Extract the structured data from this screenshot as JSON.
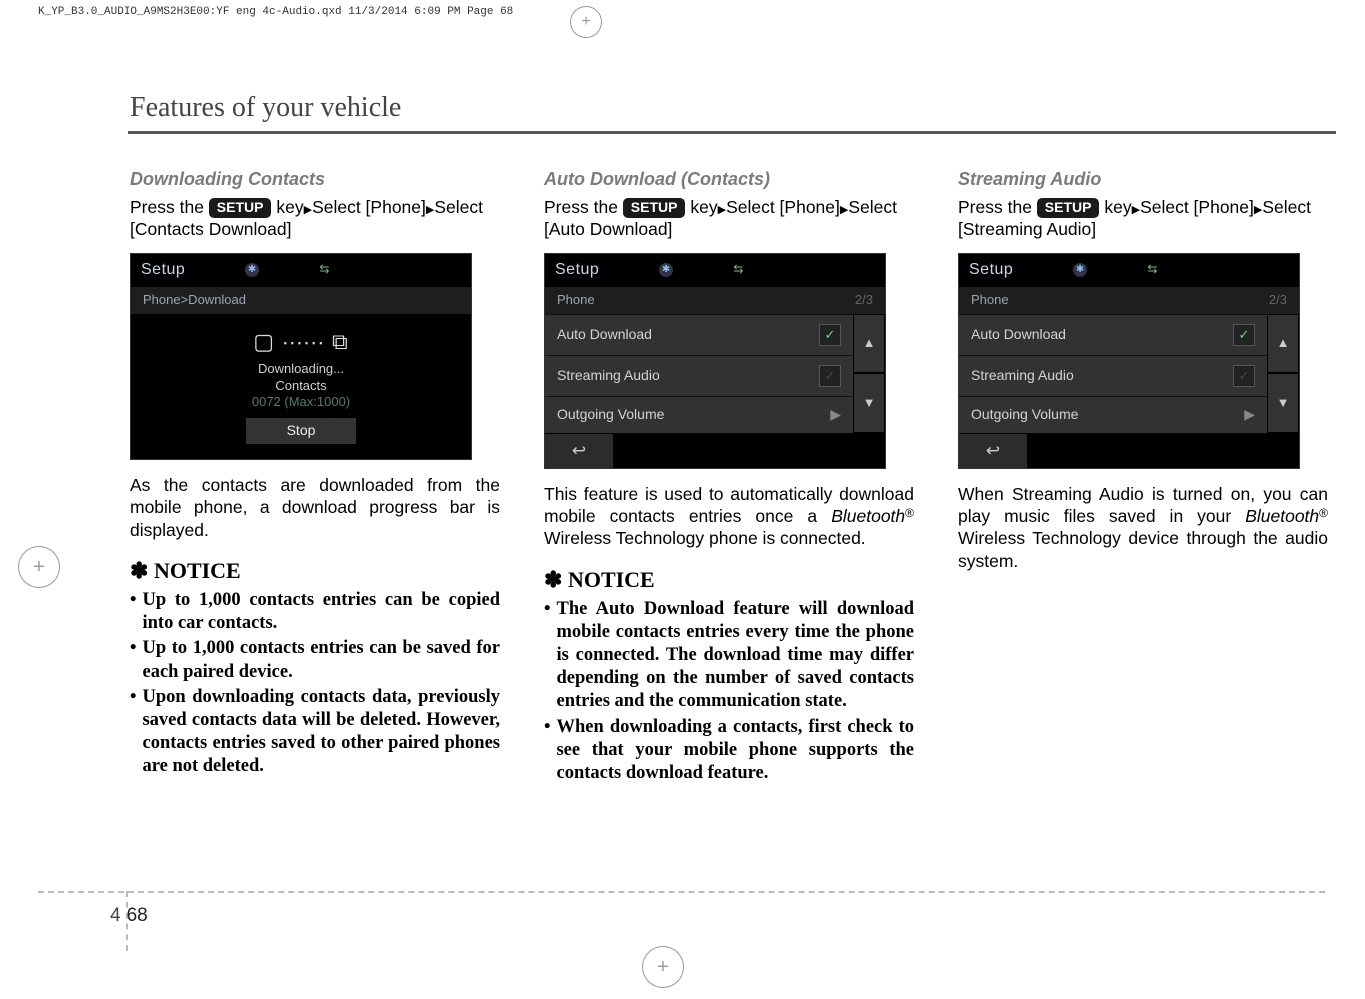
{
  "file_header": "K_YP_B3.0_AUDIO_A9MS2H3E00:YF eng 4c-Audio.qxd  11/3/2014  6:09 PM  Page 68",
  "section_title": "Features of your vehicle",
  "page_chapter": "4",
  "page_number": "68",
  "setup_label": "SETUP",
  "col1": {
    "head": "Downloading Contacts",
    "intro_a": "Press the ",
    "intro_b": " key",
    "intro_c": "Select [Phone]",
    "intro_d": "Select [Contacts Download]",
    "dev_title": "Setup",
    "dev_crumb": "Phone>Download",
    "dl_status": "Downloading...",
    "dl_label": "Contacts",
    "dl_count": "0072 (Max:1000)",
    "stop": "Stop",
    "para": "As the contacts are downloaded from the mobile phone, a download progress bar is displayed.",
    "notice": "NOTICE",
    "bullets": [
      "Up to 1,000 contacts entries can be copied into car contacts.",
      "Up to 1,000 contacts entries can be saved for each paired device.",
      "Upon downloading contacts data, previously saved contacts data will be deleted. However, contacts entries saved to other paired phones are not deleted."
    ]
  },
  "col2": {
    "head": "Auto Download (Contacts)",
    "intro_a": "Press the ",
    "intro_b": " key",
    "intro_c": "Select [Phone]",
    "intro_d": "Select [Auto Download]",
    "dev_title": "Setup",
    "dev_crumb": "Phone",
    "dev_page": "2/3",
    "items": [
      "Auto Download",
      "Streaming Audio",
      "Outgoing Volume"
    ],
    "para_a": "This feature is used to automatically download mobile contacts entries once a ",
    "para_bt": "Bluetooth",
    "para_b": " Wireless Technology phone is connected.",
    "notice": "NOTICE",
    "bullets": [
      "The Auto Download feature will download mobile contacts entries every time the phone is connected. The download time may differ depending on the number of saved contacts entries and the communi­cation state.",
      "When downloading a contacts, first check to see that your mobile phone supports the contacts download feature."
    ]
  },
  "col3": {
    "head": "Streaming Audio",
    "intro_a": "Press the ",
    "intro_b": " key",
    "intro_c": "Select [Phone]",
    "intro_d": "Select [Streaming Audio]",
    "dev_title": "Setup",
    "dev_crumb": "Phone",
    "dev_page": "2/3",
    "items": [
      "Auto Download",
      "Streaming Audio",
      "Outgoing Volume"
    ],
    "para_a": "When Streaming Audio is turned on, you can play music files saved in your ",
    "para_bt": "Bluetooth",
    "para_b": " Wireless Technology device through the audio system."
  }
}
